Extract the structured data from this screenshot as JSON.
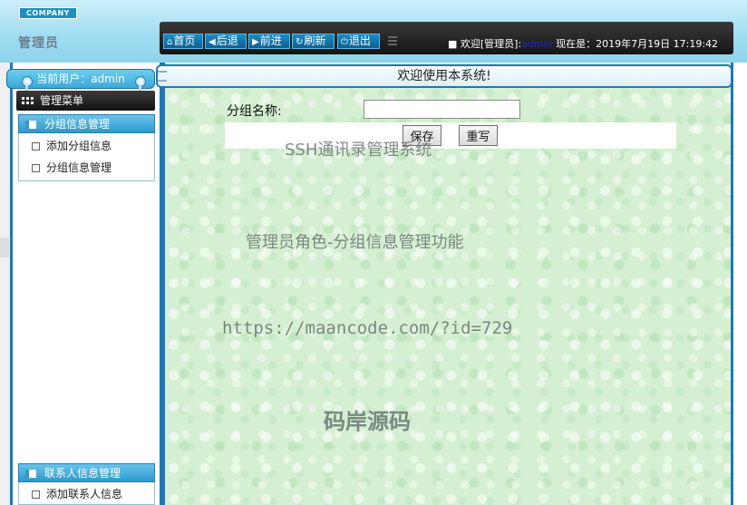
{
  "header": {
    "logo_text": "COMPANY",
    "role_title": "管理员",
    "toolbar": {
      "home": "首页",
      "back": "后退",
      "forward": "前进",
      "refresh": "刷新",
      "logout": "退出"
    },
    "status_prefix": "■ 欢迎[管理员]:",
    "status_user": "admin",
    "status_time": " 现在是：2019年7月19日 17:19:42"
  },
  "sidebar": {
    "current_user": "当前用户：admin",
    "menu_title": "管理菜单",
    "groups": [
      {
        "title": "分组信息管理",
        "items": [
          "添加分组信息",
          "分组信息管理"
        ]
      },
      {
        "title": "联系人信息管理",
        "items": [
          "添加联系人信息"
        ]
      }
    ]
  },
  "main": {
    "welcome": "欢迎使用本系统!",
    "form": {
      "group_name_label": "分组名称:",
      "group_name_value": "",
      "save_label": "保存",
      "reset_label": "重写"
    },
    "watermarks": [
      "SSH通讯录管理系统",
      "管理员角色-分组信息管理功能",
      "https://maancode.com/?id=729",
      "码岸源码"
    ]
  },
  "colors": {
    "frame_blue": "#1f78b4",
    "content_green": "#d5efd2",
    "toolbar_dark": "#1a1a1a",
    "button_blue": "#1c8bc2"
  }
}
